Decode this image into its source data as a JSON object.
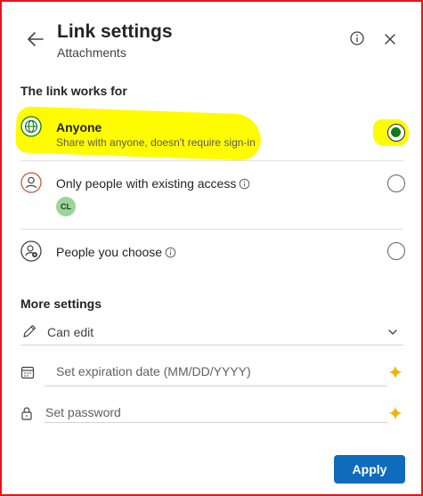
{
  "header": {
    "title": "Link settings",
    "subtitle": "Attachments",
    "icons": [
      "back-arrow-icon",
      "info-icon",
      "close-icon"
    ]
  },
  "link_works_for": {
    "heading": "The link works for",
    "options": [
      {
        "label": "Anyone",
        "sublabel": "Share with anyone, doesn't require sign-in",
        "icon": "globe-icon",
        "selected": true
      },
      {
        "label": "Only people with existing access",
        "icon": "person-icon",
        "selected": false,
        "avatar_initials": "CL"
      },
      {
        "label": "People you choose",
        "icon": "people-settings-icon",
        "selected": false
      }
    ]
  },
  "more_settings": {
    "heading": "More settings",
    "permission": "Can edit",
    "expiration_placeholder": "Set expiration date (MM/DD/YYYY)",
    "password_placeholder": "Set password"
  },
  "apply_label": "Apply",
  "colors": {
    "border": "#e8141e",
    "highlight": "#fffb00",
    "accent": "#0f6cbd",
    "selected_radio": "#107c10",
    "sparkle": "#f2b400",
    "avatar": "#9cd49a"
  }
}
